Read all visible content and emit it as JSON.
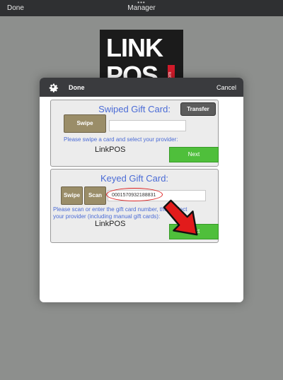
{
  "topbar": {
    "left_label": "Done",
    "title": "Manager",
    "dots": "•••"
  },
  "logo": {
    "line1": "LINK",
    "line2": "POS",
    "tag": ".com"
  },
  "dialog": {
    "done_label": "Done",
    "cancel_label": "Cancel"
  },
  "swiped": {
    "title": "Swiped Gift Card:",
    "swipe_label": "Swipe",
    "transfer_label": "Transfer",
    "hint": "Please swipe a card and select your provider:",
    "provider": "LinkPOS",
    "next_label": "Next"
  },
  "keyed": {
    "title": "Keyed Gift Card:",
    "swipe_label": "Swipe",
    "scan_label": "Scan",
    "card_number": "0001570932188831",
    "hint_line1": "Please scan or enter the gift card number, then select",
    "hint_line2": "your provider (including manual gift cards):",
    "provider": "LinkPOS",
    "next_label": "Next"
  },
  "colors": {
    "accent_text": "#4a6bd6",
    "next_green": "#4fbf3b",
    "khaki_button": "#9a8d68",
    "highlight_red": "#d22222"
  },
  "icons": [
    "gear-icon",
    "red-arrow-icon"
  ]
}
